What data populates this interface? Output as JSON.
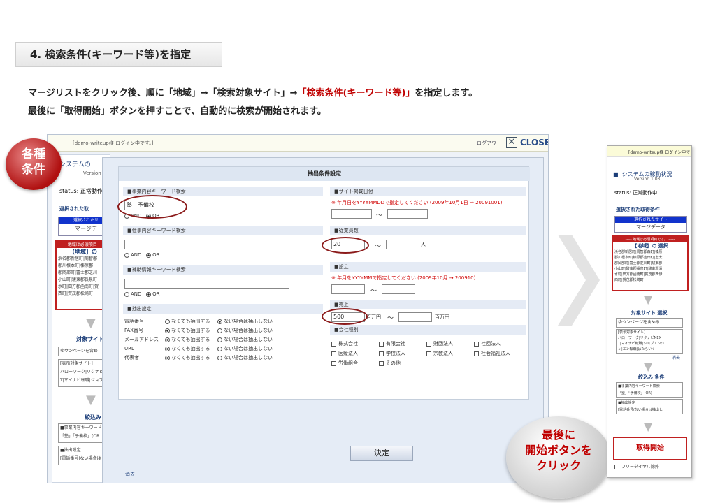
{
  "step": {
    "title": "4. 検索条件(キーワード等)を指定"
  },
  "description": {
    "line1_a": "マージリストをクリック後、順に「地域」→「検索対象サイト」→",
    "line1_red": "「検索条件(キーワード等)」",
    "line1_b": "を指定します。",
    "line2": "最後に「取得開始」ボタンを押すことで、自動的に検索が開始されます。"
  },
  "badges": {
    "left": [
      "各種",
      "条件"
    ],
    "right": [
      "最後に",
      "開始ボタンを",
      "クリック"
    ]
  },
  "app": {
    "login_text": "[demo-writeup様 ログイン中です。]",
    "close_label": "CLOSE",
    "logout_label": "ログアウ",
    "system_title": "システムの",
    "version": "Version 1.",
    "status": "status: 正常動作",
    "selected_header": "選択された取",
    "selected_site_label": "選択されたサ",
    "merge_label": "マージデ",
    "region_note": "----- 地域は必須項目",
    "region_title": "【地域】の",
    "region_lines": [
      "浜名郡新居町|周智郡",
      "郡川根本町|榛原郡",
      "郡岡部町|富士郡芝川",
      "小山町|駿東郡長泉町",
      "水町|田方郡函南町|賀",
      "西町|賀茂郡松崎町"
    ],
    "target_site": "対象サイト",
    "yuupage": "ゆウンページを含め",
    "target_lines": [
      "[表示対象サイト]",
      "ハローワーク|リクナビ",
      "T|マイナビ転職|ジョブ"
    ],
    "narrow": "絞込み 条",
    "narrow_lines": [
      "■事業内容キーワード",
      "「塾」「予備校」(OR",
      "■抽出設定",
      "[電話番号(ない場合は"
    ],
    "clear": "消去"
  },
  "modal": {
    "title": "抽出条件設定",
    "kw1_label": "■事業内容キーワード検索",
    "kw1_value": "塾　予備校",
    "and": "AND",
    "or": "OR",
    "kw2_label": "■仕事内容キーワード検索",
    "kw3_label": "■補助情報キーワード検索",
    "extract_label": "■抽出設定",
    "extract_rows": [
      {
        "label": "電話番号",
        "a": "なくても抽出する",
        "b": "ない場合は抽出しない"
      },
      {
        "label": "FAX番号",
        "a": "なくても抽出する",
        "b": "ない場合は抽出しない"
      },
      {
        "label": "メールアドレス",
        "a": "なくても抽出する",
        "b": "ない場合は抽出しない"
      },
      {
        "label": "URL",
        "a": "なくても抽出する",
        "b": "ない場合は抽出しない"
      },
      {
        "label": "代表者",
        "a": "なくても抽出する",
        "b": "ない場合は抽出しない"
      }
    ],
    "site_date_label": "■サイト掲載日付",
    "site_date_note": "※ 年月日をYYYYMMDDで指定してください (2009年10月1日 → 20091001)",
    "tilde": "～",
    "employees_label": "■従業員数",
    "employees_value": "20",
    "employees_unit": "人",
    "founded_label": "■設立",
    "founded_note": "※ 年月をYYYYMMで指定してください (2009年10月 → 200910)",
    "sales_label": "■売上",
    "sales_value": "500",
    "sales_unit": "百万円",
    "company_label": "■会社種別",
    "company_types": [
      "株式会社",
      "有限会社",
      "財団法人",
      "社団法人",
      "医療法人",
      "学校法人",
      "宗教法人",
      "社会福祉法人",
      "労働組合",
      "その他"
    ],
    "decide": "決定",
    "clear": "消去"
  },
  "right_panel": {
    "login_text": "[demo-writeup様 ログイン中で",
    "system_title": "システムの稼動状況",
    "version": "Version 1.03",
    "status": "status: 正常動作中",
    "selected_header": "選択された取得条件",
    "selected_site_label": "選択されたサイト",
    "merge_label": "マージデータ",
    "region_note": "----- 地域は必須項目です。 -----",
    "region_title": "【地域】の 選択",
    "region_lines": [
      "浜名郡新居町|周智郡森町|榛原",
      "郡川根本町|榛原郡吉田町|志太",
      "郡岡部町|富士郡芝川町|駿東郡",
      "小山町|駿東郡長泉町|駿東郡清",
      "水町|田方郡函南町|賀茂郡西伊",
      "西町|賀茂郡松崎町"
    ],
    "target_site": "対象サイト 選択",
    "yuupage": "ゆウンページを含める",
    "target_lines": [
      "[表示対象サイト]",
      "ハローワーク|リクナビNEX",
      "T|マイナビ転職|ジョブエンジ",
      "ン|エン転職|はたらいく"
    ],
    "narrow": "絞込み 条件",
    "narrow_lines": [
      "■事業内容キーワード検索",
      "「塾」「予備校」(OR)",
      "■抽出設定",
      "[電話番号(ない場合は抽出し"
    ],
    "clear": "消去",
    "start_button": "取得開始",
    "free_dial": "フリーダイヤル除外"
  }
}
